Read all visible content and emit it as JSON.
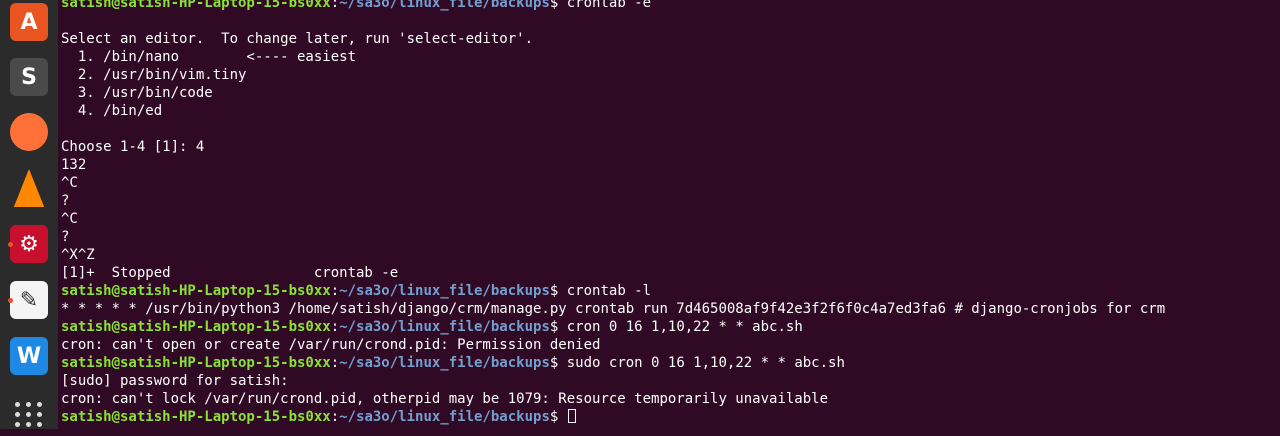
{
  "dock": {
    "items": [
      {
        "name": "ubuntu-software-icon",
        "glyph": "A",
        "bg": "#e95420",
        "active": false
      },
      {
        "name": "sublime-text-icon",
        "glyph": "S",
        "bg": "#4a4a4a",
        "active": false
      },
      {
        "name": "firefox-icon",
        "glyph": "",
        "bg": "#ff7139",
        "active": false
      },
      {
        "name": "vlc-icon",
        "glyph": "",
        "bg": "#ff8800",
        "active": false
      },
      {
        "name": "settings-icon",
        "glyph": "⚙",
        "bg": "#c8102e",
        "active": true
      },
      {
        "name": "text-editor-icon",
        "glyph": "✎",
        "bg": "#f4f4f4",
        "active": true
      },
      {
        "name": "wps-office-icon",
        "glyph": "W",
        "bg": "#1e88e5",
        "active": false
      },
      {
        "name": "show-applications-icon",
        "glyph": "",
        "bg": "transparent",
        "active": false
      }
    ]
  },
  "terminal": {
    "lines": [
      {
        "type": "prompt",
        "user": "satish@satish-HP-Laptop-15-bs0xx",
        "path": "~/sa3o/linux_file/backups",
        "cmd": " crontab -e"
      },
      {
        "type": "blank",
        "text": ""
      },
      {
        "type": "out",
        "text": "Select an editor.  To change later, run 'select-editor'."
      },
      {
        "type": "out",
        "text": "  1. /bin/nano        <---- easiest"
      },
      {
        "type": "out",
        "text": "  2. /usr/bin/vim.tiny"
      },
      {
        "type": "out",
        "text": "  3. /usr/bin/code"
      },
      {
        "type": "out",
        "text": "  4. /bin/ed"
      },
      {
        "type": "blank",
        "text": ""
      },
      {
        "type": "out",
        "text": "Choose 1-4 [1]: 4"
      },
      {
        "type": "out",
        "text": "132"
      },
      {
        "type": "out",
        "text": "^C"
      },
      {
        "type": "out",
        "text": "?"
      },
      {
        "type": "out",
        "text": "^C"
      },
      {
        "type": "out",
        "text": "?"
      },
      {
        "type": "out",
        "text": "^X^Z"
      },
      {
        "type": "out",
        "text": "[1]+  Stopped                 crontab -e"
      },
      {
        "type": "prompt",
        "user": "satish@satish-HP-Laptop-15-bs0xx",
        "path": "~/sa3o/linux_file/backups",
        "cmd": " crontab -l"
      },
      {
        "type": "out",
        "text": "* * * * * /usr/bin/python3 /home/satish/django/crm/manage.py crontab run 7d465008af9f42e3f2f6f0c4a7ed3fa6 # django-cronjobs for crm"
      },
      {
        "type": "prompt",
        "user": "satish@satish-HP-Laptop-15-bs0xx",
        "path": "~/sa3o/linux_file/backups",
        "cmd": " cron 0 16 1,10,22 * * abc.sh"
      },
      {
        "type": "out",
        "text": "cron: can't open or create /var/run/crond.pid: Permission denied"
      },
      {
        "type": "prompt",
        "user": "satish@satish-HP-Laptop-15-bs0xx",
        "path": "~/sa3o/linux_file/backups",
        "cmd": " sudo cron 0 16 1,10,22 * * abc.sh"
      },
      {
        "type": "out",
        "text": "[sudo] password for satish:"
      },
      {
        "type": "out",
        "text": "cron: can't lock /var/run/crond.pid, otherpid may be 1079: Resource temporarily unavailable"
      },
      {
        "type": "prompt",
        "user": "satish@satish-HP-Laptop-15-bs0xx",
        "path": "~/sa3o/linux_file/backups",
        "cmd": " ",
        "cursor": true
      }
    ]
  },
  "colors": {
    "background": "#300a24",
    "user": "#8ae234",
    "path": "#729fcf",
    "text": "#ffffff",
    "dock": "#2b2b2b",
    "indicator": "#e95420"
  }
}
